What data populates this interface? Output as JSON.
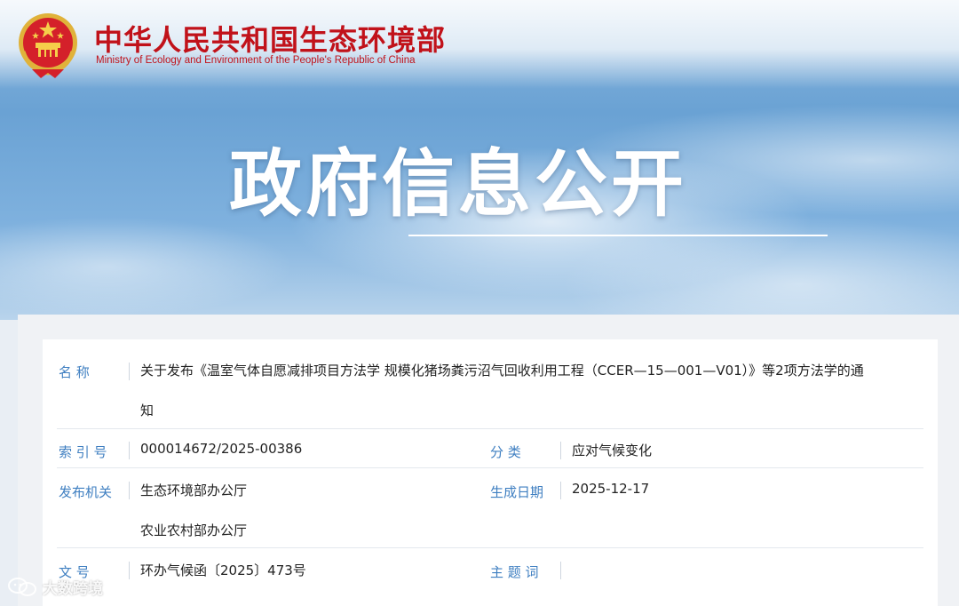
{
  "header": {
    "ministry_cn": "中华人民共和国生态环境部",
    "ministry_en": "Ministry of Ecology and Environment of the People's Republic of China",
    "brand_color": "#c1121a",
    "emblem_icon": "national-emblem-icon"
  },
  "hero": {
    "title": "政府信息公开"
  },
  "info": {
    "name_label": "名 称",
    "name_value_line1": "关于发布《温室气体自愿减排项目方法学 规模化猪场粪污沼气回收利用工程（CCER—15—001—V01）》等2项方法学的通",
    "name_value_line2": "知",
    "index_label": "索 引 号",
    "index_value": "000014672/2025-00386",
    "category_label": "分 类",
    "category_value": "应对气候变化",
    "publisher_label": "发布机关",
    "publisher_value_1": "生态环境部办公厅",
    "publisher_value_2": "农业农村部办公厅",
    "date_label": "生成日期",
    "date_value": "2025-12-17",
    "docno_label": "文 号",
    "docno_value": "环办气候函〔2025〕473号",
    "subject_label": "主 题 词",
    "subject_value": "",
    "label_color": "#3f7fc1"
  },
  "watermark": {
    "text": "大数跨境",
    "icon": "wechat-logo-icon"
  }
}
